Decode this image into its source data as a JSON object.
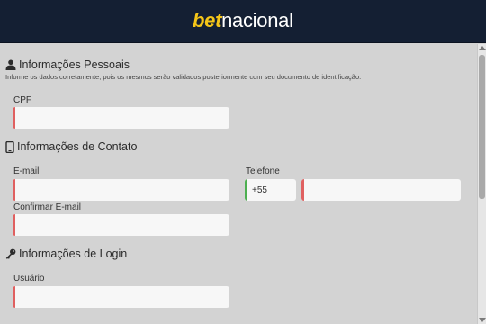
{
  "header": {
    "logo_part1": "bet",
    "logo_part2": "nacional"
  },
  "personal": {
    "title": "Informações Pessoais",
    "helper": "Informe os dados corretamente, pois os mesmos serão validados posteriormente com seu documento de identificação.",
    "cpf_label": "CPF",
    "cpf_value": ""
  },
  "contact": {
    "title": "Informações de Contato",
    "email_label": "E-mail",
    "email_value": "",
    "phone_label": "Telefone",
    "phone_code": "+55",
    "phone_value": "",
    "confirm_email_label": "Confirmar E-mail",
    "confirm_email_value": ""
  },
  "login": {
    "title": "Informações de Login",
    "user_label": "Usuário",
    "user_value": ""
  },
  "icons": {
    "personal": "user-icon",
    "contact": "mobile-phone-icon",
    "login": "key-icon"
  },
  "colors": {
    "header_bg": "#141f33",
    "brand_yellow": "#f5c518",
    "invalid_marker": "#e06060",
    "valid_marker": "#4caf50"
  }
}
